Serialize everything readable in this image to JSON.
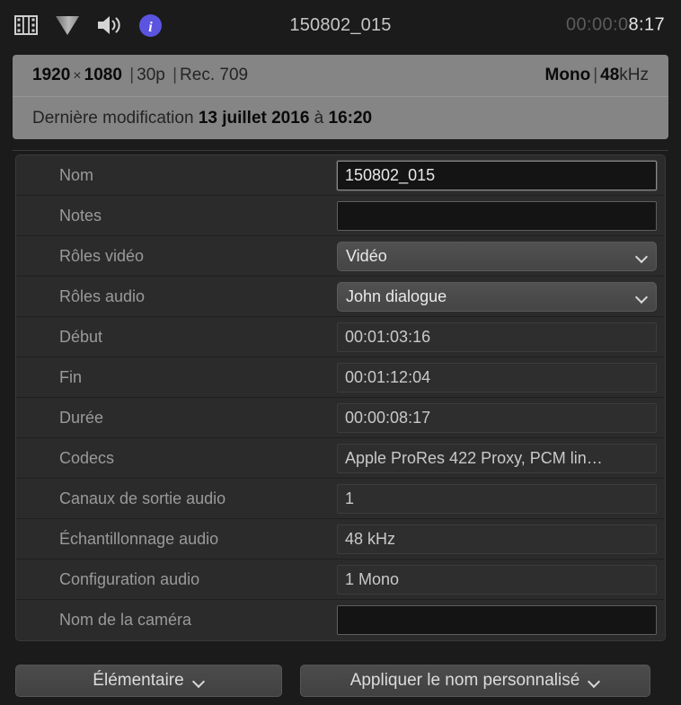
{
  "header": {
    "icons": [
      {
        "name": "film-strip-icon",
        "label": "film-strip"
      },
      {
        "name": "triangle-icon",
        "label": "triangle"
      },
      {
        "name": "speaker-icon",
        "label": "speaker"
      },
      {
        "name": "info-icon",
        "label": "info"
      }
    ],
    "title": "150802_015",
    "timecode_dim": "00:00:0",
    "timecode_lit": "8:17",
    "info_badge_color": "#5b54e0"
  },
  "info_panel": {
    "width": "1920",
    "times": "×",
    "height": "1080",
    "sep1": "|",
    "framerate": "30p",
    "sep2": "|",
    "colorspace": "Rec. 709",
    "audio_channels": "Mono",
    "sep3": "|",
    "sample_rate_num": "48",
    "sample_rate_unit": "kHz",
    "modified_prefix": "Dernière modification",
    "modified_date": "13 juillet 2016",
    "modified_at": "à",
    "modified_time": "16:20"
  },
  "fields": [
    {
      "label": "Nom",
      "value": "150802_015",
      "type": "text",
      "focused": true
    },
    {
      "label": "Notes",
      "value": "",
      "type": "text",
      "focused": false
    },
    {
      "label": "Rôles vidéo",
      "value": "Vidéo",
      "type": "select"
    },
    {
      "label": "Rôles audio",
      "value": "John dialogue",
      "type": "select"
    },
    {
      "label": "Début",
      "value": "00:01:03:16",
      "type": "readonly"
    },
    {
      "label": "Fin",
      "value": "00:01:12:04",
      "type": "readonly"
    },
    {
      "label": "Durée",
      "value": "00:00:08:17",
      "type": "readonly"
    },
    {
      "label": "Codecs",
      "value": "Apple ProRes 422 Proxy, PCM lin…",
      "type": "readonly"
    },
    {
      "label": "Canaux de sortie audio",
      "value": "1",
      "type": "readonly"
    },
    {
      "label": "Échantillonnage audio",
      "value": "48 kHz",
      "type": "readonly"
    },
    {
      "label": "Configuration audio",
      "value": "1 Mono",
      "type": "readonly"
    },
    {
      "label": "Nom de la caméra",
      "value": "",
      "type": "text",
      "focused": false
    }
  ],
  "bottom": {
    "view_button": "Élémentaire",
    "apply_button": "Appliquer le nom personnalisé"
  }
}
